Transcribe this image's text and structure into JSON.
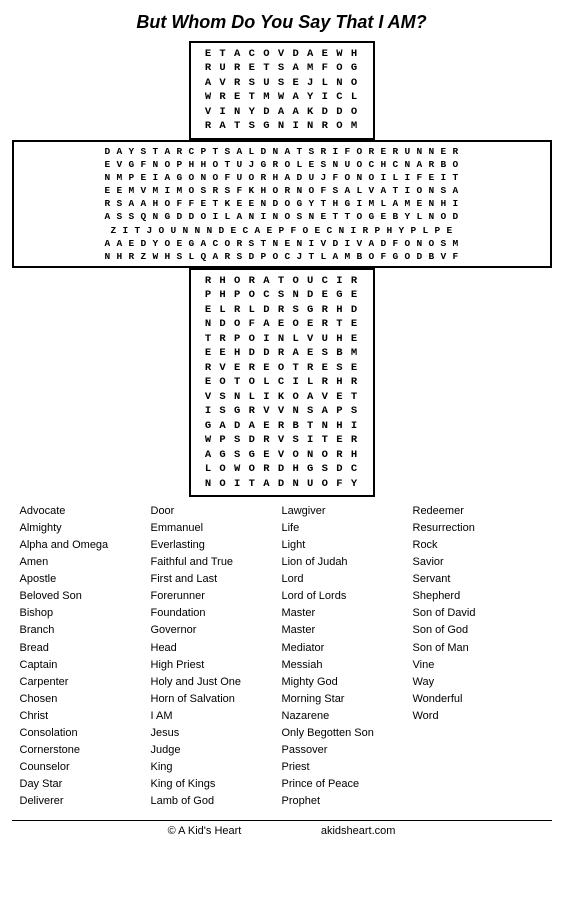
{
  "title": "But Whom Do You Say That I AM?",
  "grid": {
    "top": [
      "E T A C O V D A E W H",
      "R U R E T S A M F O G",
      "A V R S U S E J L N O",
      "W R E T M W A Y I C L",
      "V I N Y D A A K D D O",
      "R A T S G N I N R O M"
    ],
    "middle_wide": [
      "D A Y S T A R C P T S A L D N A T S R I F O R E R U N N E R",
      "E V G F N O P H H O T U J G R O L E S N U O C H C N A R B O",
      "N M P E I A G O N O F U O R H A D U J F O N O I L I F E I T",
      "E E M V M I M O S R S F K H O R N O F S A L V A T I O N S A",
      "R S A A H O F F E T K E E N D O G Y T H G I M L A M E N H I",
      "A S S Q N G D D O I L A N I N O S N E T T O G E B Y L N O D",
      "Z I T J O U N N N D E C A E P F O E C N I R P H Y P L P E",
      "A A E D Y O E G A C O R S T N E N I V D I V A D F O N O S M",
      "N H R Z W H S L Q A R S D P O C J T L A M B O F G O D B V F"
    ],
    "center": [
      "R H O R A T O U C I R",
      "P H P O C S N D E G E",
      "E L R L D R S G R H D",
      "N D O F A E O E R T E",
      "T R P O I N L V U H E",
      "E E H D D R A E S B M",
      "R V E R E O T R E S E",
      "E O T O L C I L R H R",
      "V S N L I K O A V E T",
      "I S G R V V N S A P S",
      "G A D A E R B T N H I",
      "W P S D R V S I T E R",
      "A G S G E V O N O R H",
      "L O W O R D H G S D C",
      "N O I T A D N U O F Y"
    ]
  },
  "words": {
    "col1": [
      "Advocate",
      "Almighty",
      "Alpha and Omega",
      "Amen",
      "Apostle",
      "Beloved Son",
      "Bishop",
      "Branch",
      "Bread",
      "Captain",
      "Carpenter",
      "Chosen",
      "Christ",
      "Consolation",
      "Cornerstone",
      "Counselor",
      "Day Star",
      "Deliverer"
    ],
    "col2": [
      "Door",
      "Emmanuel",
      "Everlasting",
      "Faithful and True",
      "First and Last",
      "Forerunner",
      "Foundation",
      "Governor",
      "Head",
      "High Priest",
      "Holy and Just One",
      "Horn of Salvation",
      "I AM",
      "Jesus",
      "Judge",
      "King",
      "King of Kings",
      "Lamb of God"
    ],
    "col3": [
      "Lawgiver",
      "Life",
      "Light",
      "Lion of Judah",
      "Lord",
      "Lord of Lords",
      "Master",
      "Master",
      "Mediator",
      "Messiah",
      "Mighty God",
      "Morning Star",
      "Nazarene",
      "Only Begotten Son",
      "Passover",
      "Priest",
      "Prince of Peace",
      "Prophet"
    ],
    "col4": [
      "Redeemer",
      "Resurrection",
      "Rock",
      "Savior",
      "Servant",
      "Shepherd",
      "Son of David",
      "Son of God",
      "Son of Man",
      "Vine",
      "Way",
      "Wonderful",
      "Word"
    ]
  },
  "footer": {
    "left": "© A Kid's Heart",
    "right": "akidsheart.com"
  }
}
